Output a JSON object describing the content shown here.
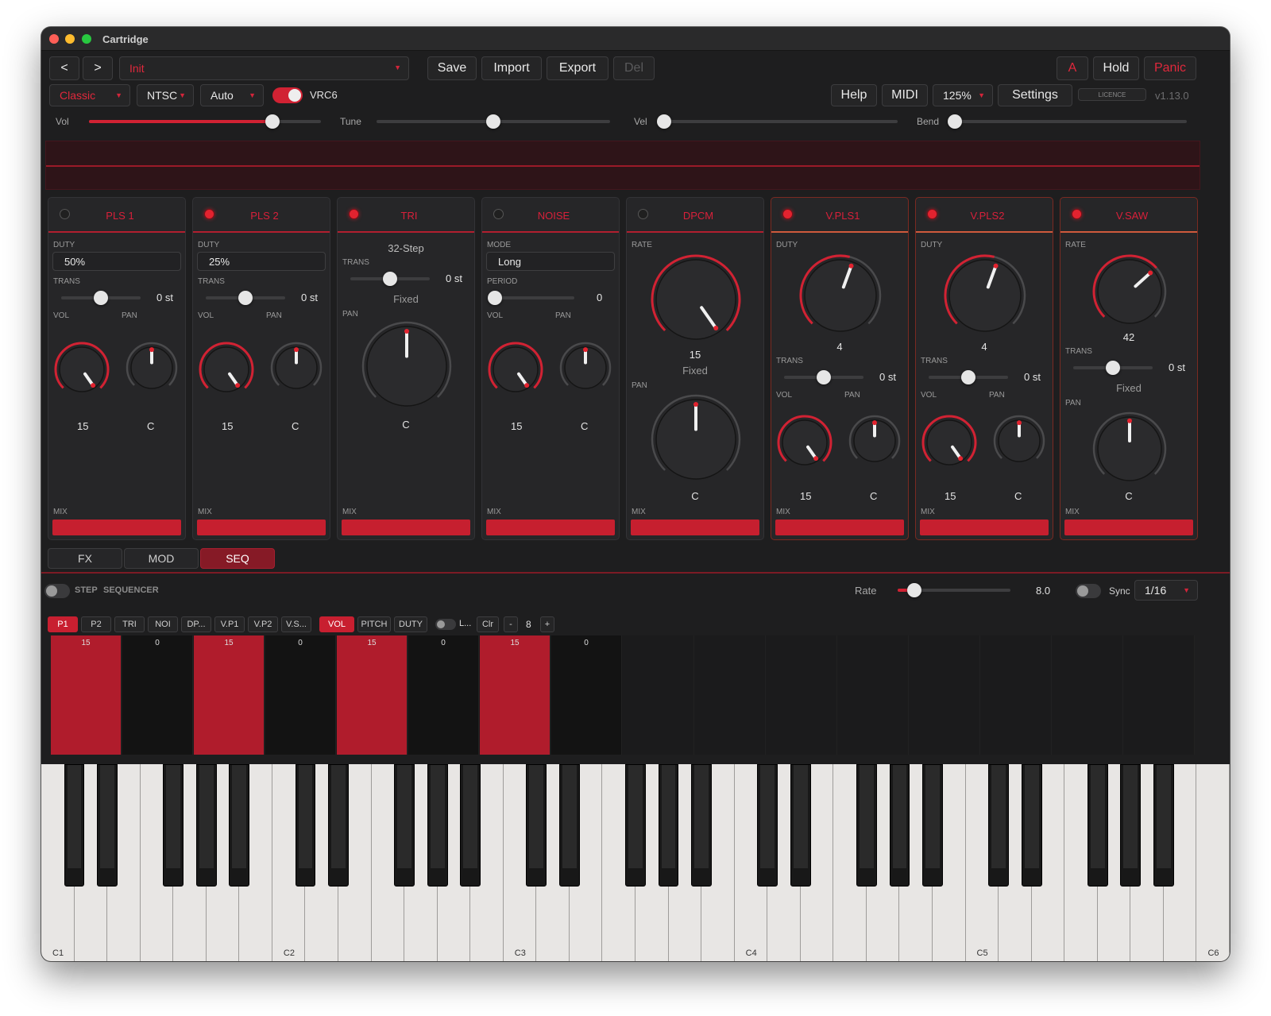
{
  "window": {
    "title": "Cartridge"
  },
  "toolbar1": {
    "prev": "<",
    "next": ">",
    "preset": "Init",
    "save": "Save",
    "import": "Import",
    "export": "Export",
    "del": "Del",
    "a": "A",
    "hold": "Hold",
    "panic": "Panic"
  },
  "toolbar2": {
    "mode": "Classic",
    "region": "NTSC",
    "auto": "Auto",
    "vrc6_label": "VRC6",
    "vrc6_on": true,
    "help": "Help",
    "midi": "MIDI",
    "zoom": "125%",
    "settings": "Settings",
    "licence": "LICENCE",
    "version": "v1.13.0"
  },
  "sliders": {
    "vol_label": "Vol",
    "vol_value": 0.79,
    "tune_label": "Tune",
    "tune_value": 0.5,
    "vel_label": "Vel",
    "vel_value": 0.0,
    "bend_label": "Bend",
    "bend_value": 0.0
  },
  "channels": [
    {
      "name": "PLS 1",
      "on": false,
      "duty_label": "DUTY",
      "duty": "50%",
      "trans_label": "TRANS",
      "trans": "0 st",
      "trans_pos": 0.5,
      "vol_label": "VOL",
      "pan_label": "PAN",
      "vol": "15",
      "pan": "C",
      "mix_label": "MIX"
    },
    {
      "name": "PLS 2",
      "on": true,
      "duty_label": "DUTY",
      "duty": "25%",
      "trans_label": "TRANS",
      "trans": "0 st",
      "trans_pos": 0.5,
      "vol_label": "VOL",
      "pan_label": "PAN",
      "vol": "15",
      "pan": "C",
      "mix_label": "MIX"
    },
    {
      "name": "TRI",
      "on": true,
      "step": "32-Step",
      "trans_label": "TRANS",
      "trans": "0 st",
      "trans_pos": 0.5,
      "fixed": "Fixed",
      "pan_label": "PAN",
      "pan": "C",
      "mix_label": "MIX"
    },
    {
      "name": "NOISE",
      "on": false,
      "mode_label": "MODE",
      "mode": "Long",
      "period_label": "PERIOD",
      "period": "0",
      "period_pos": 0.0,
      "vol_label": "VOL",
      "pan_label": "PAN",
      "vol": "15",
      "pan": "C",
      "mix_label": "MIX"
    },
    {
      "name": "DPCM",
      "on": false,
      "rate_label": "RATE",
      "rate": "15",
      "fixed": "Fixed",
      "pan_label": "PAN",
      "pan": "C",
      "mix_label": "MIX"
    },
    {
      "name": "V.PLS1",
      "on": true,
      "duty_label": "DUTY",
      "duty": "4",
      "trans_label": "TRANS",
      "trans": "0 st",
      "trans_pos": 0.5,
      "vol_label": "VOL",
      "pan_label": "PAN",
      "vol": "15",
      "pan": "C",
      "mix_label": "MIX"
    },
    {
      "name": "V.PLS2",
      "on": true,
      "duty_label": "DUTY",
      "duty": "4",
      "trans_label": "TRANS",
      "trans": "0 st",
      "trans_pos": 0.5,
      "vol_label": "VOL",
      "pan_label": "PAN",
      "vol": "15",
      "pan": "C",
      "mix_label": "MIX"
    },
    {
      "name": "V.SAW",
      "on": true,
      "rate_label": "RATE",
      "rate": "42",
      "trans_label": "TRANS",
      "trans": "0 st",
      "trans_pos": 0.5,
      "fixed": "Fixed",
      "pan_label": "PAN",
      "pan": "C",
      "mix_label": "MIX"
    }
  ],
  "tabs": {
    "fx": "FX",
    "mod": "MOD",
    "seq": "SEQ",
    "active": "SEQ"
  },
  "sequencer": {
    "enabled": false,
    "step_label": "STEP",
    "title": "SEQUENCER",
    "rate_label": "Rate",
    "rate": "8.0",
    "rate_pos": 0.15,
    "sync_label": "Sync",
    "sync_on": false,
    "division": "1/16",
    "tracks": [
      "P1",
      "P2",
      "TRI",
      "NOI",
      "DP...",
      "V.P1",
      "V.P2",
      "V.S..."
    ],
    "active_track": "P1",
    "params": [
      "VOL",
      "PITCH",
      "DUTY"
    ],
    "active_param": "VOL",
    "link_label": "L...",
    "clear": "Clr",
    "minus": "-",
    "length": "8",
    "plus": "+",
    "steps": [
      "15",
      "0",
      "15",
      "0",
      "15",
      "0",
      "15",
      "0"
    ],
    "total_columns": 16
  },
  "keyboard": {
    "octave_labels": [
      "C1",
      "C2",
      "C3",
      "C4",
      "C5",
      "C6"
    ]
  },
  "colors": {
    "accent": "#d12233",
    "panel": "#262628",
    "background": "#1e1e1f"
  }
}
